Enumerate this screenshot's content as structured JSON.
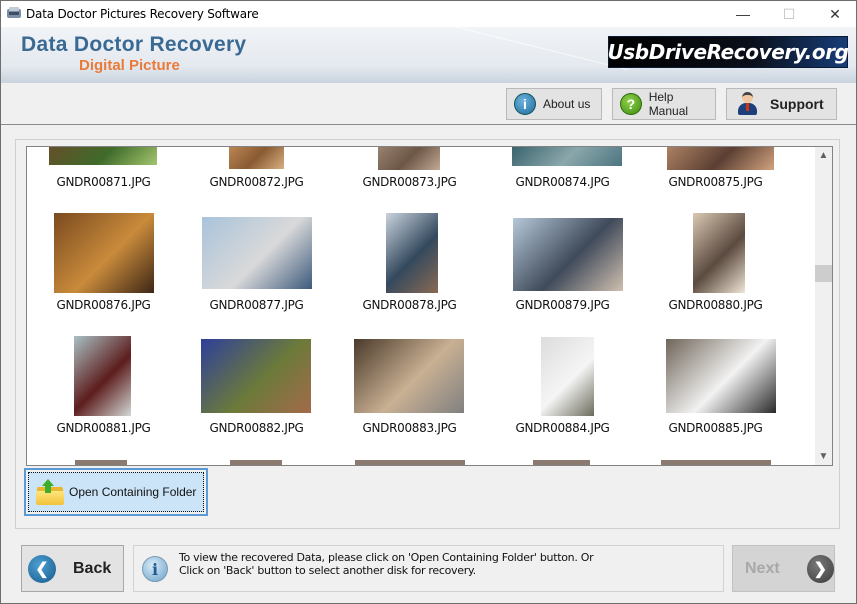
{
  "window": {
    "title": "Data Doctor Pictures Recovery Software",
    "controls": {
      "minimize": "—",
      "maximize": "☐",
      "close": "✕"
    }
  },
  "banner": {
    "brand_main": "Data Doctor Recovery",
    "brand_sub": "Digital Picture",
    "site_badge": "UsbDriveRecovery.org",
    "colors": {
      "brand_main": "#3a6a94",
      "brand_sub": "#e97a3a"
    }
  },
  "toolbar": {
    "about_label": "About us",
    "about_icon": "i",
    "help_label": "Help Manual",
    "help_icon": "?",
    "support_label": "Support"
  },
  "gallery": {
    "scroll_position_fraction": 0.38,
    "scroll_up_glyph": "⌃",
    "scroll_down_glyph": "⌄",
    "items": [
      {
        "name": "GNDR00871.JPG"
      },
      {
        "name": "GNDR00872.JPG"
      },
      {
        "name": "GNDR00873.JPG"
      },
      {
        "name": "GNDR00874.JPG"
      },
      {
        "name": "GNDR00875.JPG"
      },
      {
        "name": "GNDR00876.JPG"
      },
      {
        "name": "GNDR00877.JPG"
      },
      {
        "name": "GNDR00878.JPG"
      },
      {
        "name": "GNDR00879.JPG"
      },
      {
        "name": "GNDR00880.JPG"
      },
      {
        "name": "GNDR00881.JPG"
      },
      {
        "name": "GNDR00882.JPG"
      },
      {
        "name": "GNDR00883.JPG"
      },
      {
        "name": "GNDR00884.JPG"
      },
      {
        "name": "GNDR00885.JPG"
      }
    ]
  },
  "open_folder_button": {
    "label": "Open Containing Folder"
  },
  "footer": {
    "back_label": "Back",
    "back_glyph": "❮",
    "info_icon": "i",
    "info_line1": "To view the recovered Data, please click on 'Open Containing Folder' button. Or",
    "info_line2": "Click on 'Back' button to select another disk for recovery.",
    "next_label": "Next",
    "next_glyph": "❯",
    "next_enabled": false
  }
}
